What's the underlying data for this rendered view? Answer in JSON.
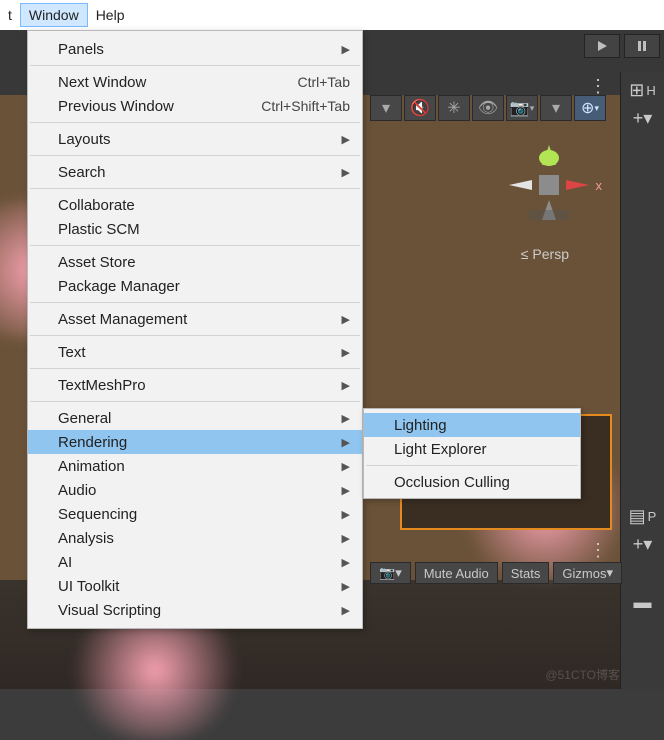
{
  "menubar": {
    "items": [
      "t",
      "Window",
      "Help"
    ],
    "active_index": 1
  },
  "dropdown": {
    "items": [
      {
        "label": "Panels",
        "submenu": true
      },
      {
        "sep": true
      },
      {
        "label": "Next Window",
        "shortcut": "Ctrl+Tab"
      },
      {
        "label": "Previous Window",
        "shortcut": "Ctrl+Shift+Tab"
      },
      {
        "sep": true
      },
      {
        "label": "Layouts",
        "submenu": true
      },
      {
        "sep": true
      },
      {
        "label": "Search",
        "submenu": true
      },
      {
        "sep": true
      },
      {
        "label": "Collaborate"
      },
      {
        "label": "Plastic SCM"
      },
      {
        "sep": true
      },
      {
        "label": "Asset Store"
      },
      {
        "label": "Package Manager"
      },
      {
        "sep": true
      },
      {
        "label": "Asset Management",
        "submenu": true
      },
      {
        "sep": true
      },
      {
        "label": "Text",
        "submenu": true
      },
      {
        "sep": true
      },
      {
        "label": "TextMeshPro",
        "submenu": true
      },
      {
        "sep": true
      },
      {
        "label": "General",
        "submenu": true
      },
      {
        "label": "Rendering",
        "submenu": true,
        "highlight": true
      },
      {
        "label": "Animation",
        "submenu": true
      },
      {
        "label": "Audio",
        "submenu": true
      },
      {
        "label": "Sequencing",
        "submenu": true
      },
      {
        "label": "Analysis",
        "submenu": true
      },
      {
        "label": "AI",
        "submenu": true
      },
      {
        "label": "UI Toolkit",
        "submenu": true
      },
      {
        "label": "Visual Scripting",
        "submenu": true
      }
    ]
  },
  "submenu": {
    "items": [
      {
        "label": "Lighting",
        "highlight": true
      },
      {
        "label": "Light Explorer"
      },
      {
        "sep": true
      },
      {
        "label": "Occlusion Culling"
      }
    ]
  },
  "viewport": {
    "projection_label": "Persp",
    "x_axis_label": "x"
  },
  "scene_footer": {
    "mute_audio": "Mute Audio",
    "stats": "Stats",
    "gizmos": "Gizmos"
  },
  "right_tabs": {
    "top1": "H",
    "top2": "P"
  },
  "watermark": "@51CTO博客"
}
